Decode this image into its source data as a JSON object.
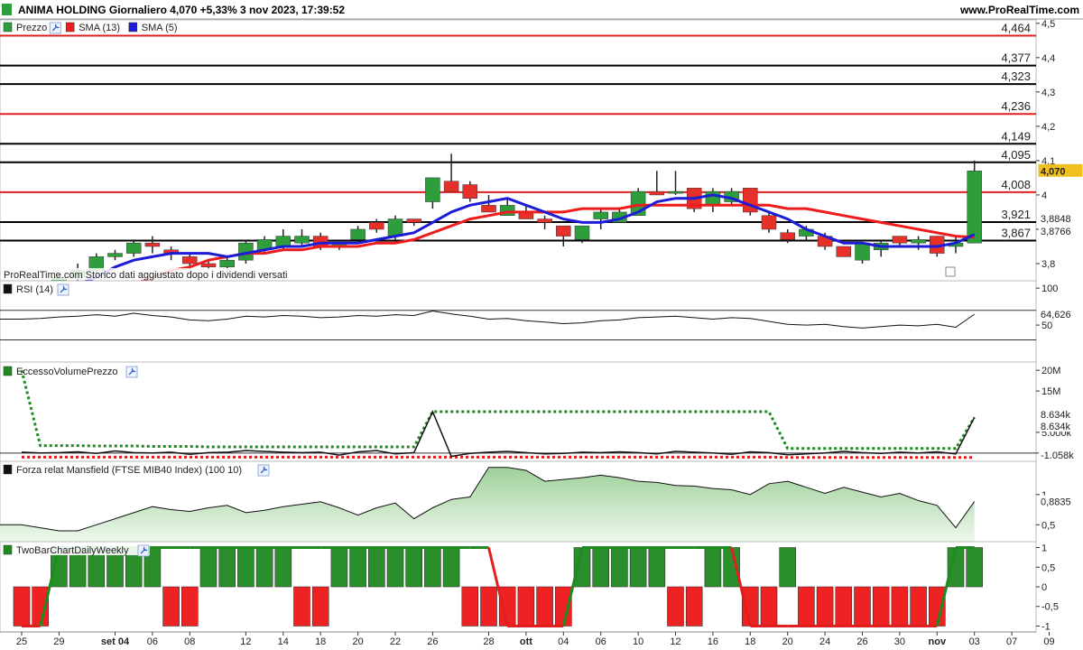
{
  "header": {
    "title": "ANIMA HOLDING Giornaliero 4,070 +5,33% 3 nov 2023, 17:39:52",
    "site": "www.ProRealTime.com"
  },
  "colors": {
    "up": "#2e9e3c",
    "down": "#e8302a",
    "sma13": "#ee1c1c",
    "sma5": "#1c1cd6",
    "current_price_bg": "#f0c020"
  },
  "chart_data": [
    {
      "id": "price",
      "type": "candlestick",
      "legend": [
        {
          "label": "Prezzo",
          "color": "#2e9e3c"
        },
        {
          "label": "SMA (13)",
          "color": "#ee1c1c"
        },
        {
          "label": "SMA (5)",
          "color": "#1c1cd6"
        }
      ],
      "ylim": [
        3.75,
        4.51
      ],
      "yticks": [
        3.8,
        3.9,
        4.0,
        4.1,
        4.2,
        4.3,
        4.4,
        4.5
      ],
      "ytick_labels": [
        "3,8",
        "3,9",
        "4",
        "4,1",
        "4,2",
        "4,3",
        "4,4",
        "4,5"
      ],
      "note": "ProRealTime.com Storico dati aggiustato dopo i dividendi versati",
      "candles": [
        [
          3.66,
          3.72,
          3.64,
          3.7
        ],
        [
          3.7,
          3.74,
          3.68,
          3.73
        ],
        [
          3.73,
          3.77,
          3.72,
          3.76
        ],
        [
          3.76,
          3.8,
          3.75,
          3.78
        ],
        [
          3.78,
          3.83,
          3.77,
          3.82
        ],
        [
          3.82,
          3.84,
          3.81,
          3.83
        ],
        [
          3.83,
          3.87,
          3.82,
          3.86
        ],
        [
          3.86,
          3.88,
          3.83,
          3.85
        ],
        [
          3.84,
          3.85,
          3.81,
          3.83
        ],
        [
          3.82,
          3.83,
          3.78,
          3.8
        ],
        [
          3.8,
          3.81,
          3.78,
          3.79
        ],
        [
          3.79,
          3.82,
          3.77,
          3.81
        ],
        [
          3.81,
          3.87,
          3.8,
          3.86
        ],
        [
          3.84,
          3.88,
          3.83,
          3.87
        ],
        [
          3.85,
          3.9,
          3.84,
          3.88
        ],
        [
          3.86,
          3.9,
          3.85,
          3.88
        ],
        [
          3.88,
          3.89,
          3.84,
          3.85
        ],
        [
          3.85,
          3.87,
          3.84,
          3.86
        ],
        [
          3.87,
          3.91,
          3.86,
          3.9
        ],
        [
          3.92,
          3.93,
          3.89,
          3.9
        ],
        [
          3.88,
          3.94,
          3.87,
          3.93
        ],
        [
          3.93,
          3.93,
          3.91,
          3.92
        ],
        [
          3.98,
          4.05,
          3.96,
          4.05
        ],
        [
          4.04,
          4.12,
          4.01,
          4.01
        ],
        [
          4.03,
          4.04,
          3.98,
          3.99
        ],
        [
          3.97,
          4.0,
          3.95,
          3.95
        ],
        [
          3.94,
          3.99,
          3.94,
          3.97
        ],
        [
          3.95,
          3.97,
          3.93,
          3.93
        ],
        [
          3.93,
          3.94,
          3.9,
          3.92
        ],
        [
          3.91,
          3.91,
          3.85,
          3.88
        ],
        [
          3.87,
          3.91,
          3.86,
          3.91
        ],
        [
          3.93,
          3.96,
          3.9,
          3.95
        ],
        [
          3.92,
          3.96,
          3.92,
          3.95
        ],
        [
          3.94,
          4.02,
          3.94,
          4.01
        ],
        [
          4.01,
          4.07,
          4.0,
          4.0
        ],
        [
          4.01,
          4.07,
          4.0,
          4.01
        ],
        [
          4.02,
          4.02,
          3.95,
          3.96
        ],
        [
          3.97,
          4.02,
          3.95,
          4.01
        ],
        [
          3.98,
          4.02,
          3.97,
          4.01
        ],
        [
          4.02,
          4.02,
          3.94,
          3.95
        ],
        [
          3.94,
          3.95,
          3.89,
          3.9
        ],
        [
          3.89,
          3.9,
          3.86,
          3.87
        ],
        [
          3.88,
          3.91,
          3.87,
          3.9
        ],
        [
          3.88,
          3.89,
          3.84,
          3.85
        ],
        [
          3.85,
          3.85,
          3.82,
          3.82
        ],
        [
          3.81,
          3.86,
          3.8,
          3.86
        ],
        [
          3.84,
          3.87,
          3.82,
          3.86
        ],
        [
          3.88,
          3.88,
          3.85,
          3.86
        ],
        [
          3.86,
          3.88,
          3.84,
          3.87
        ],
        [
          3.88,
          3.88,
          3.82,
          3.83
        ],
        [
          3.85,
          3.88,
          3.83,
          3.86
        ],
        [
          3.86,
          4.1,
          3.86,
          4.07
        ]
      ],
      "sma13": [
        3.59,
        3.62,
        3.64,
        3.66,
        3.69,
        3.72,
        3.74,
        3.76,
        3.78,
        3.79,
        3.81,
        3.82,
        3.83,
        3.83,
        3.84,
        3.84,
        3.85,
        3.85,
        3.85,
        3.86,
        3.86,
        3.87,
        3.89,
        3.91,
        3.93,
        3.94,
        3.95,
        3.95,
        3.95,
        3.95,
        3.96,
        3.96,
        3.96,
        3.97,
        3.97,
        3.97,
        3.97,
        3.97,
        3.97,
        3.97,
        3.97,
        3.96,
        3.96,
        3.95,
        3.94,
        3.93,
        3.92,
        3.91,
        3.9,
        3.89,
        3.88,
        3.8766
      ],
      "sma5": [
        3.65,
        3.68,
        3.71,
        3.74,
        3.76,
        3.79,
        3.81,
        3.82,
        3.83,
        3.83,
        3.83,
        3.82,
        3.83,
        3.84,
        3.85,
        3.85,
        3.86,
        3.86,
        3.86,
        3.87,
        3.88,
        3.89,
        3.92,
        3.95,
        3.97,
        3.98,
        3.99,
        3.97,
        3.95,
        3.93,
        3.92,
        3.92,
        3.93,
        3.95,
        3.98,
        3.99,
        3.99,
        4.0,
        3.99,
        3.97,
        3.95,
        3.93,
        3.9,
        3.88,
        3.86,
        3.86,
        3.85,
        3.85,
        3.85,
        3.85,
        3.86,
        3.8848
      ],
      "levels": [
        {
          "value": 4.464,
          "label": "4,464",
          "color": "#e02020"
        },
        {
          "value": 4.377,
          "label": "4,377",
          "color": "#000000"
        },
        {
          "value": 4.323,
          "label": "4,323",
          "color": "#000000"
        },
        {
          "value": 4.236,
          "label": "4,236",
          "color": "#e02020"
        },
        {
          "value": 4.149,
          "label": "4,149",
          "color": "#000000"
        },
        {
          "value": 4.095,
          "label": "4,095",
          "color": "#000000"
        },
        {
          "value": 4.008,
          "label": "4,008",
          "color": "#e02020"
        },
        {
          "value": 3.921,
          "label": "3,921",
          "color": "#000000"
        },
        {
          "value": 3.867,
          "label": "3,867",
          "color": "#000000"
        }
      ],
      "tags": [
        {
          "value": 4.07,
          "label": "4,070"
        },
        {
          "value": 3.8848,
          "label": "3,8848"
        },
        {
          "value": 3.8766,
          "label": "3,8766"
        }
      ]
    },
    {
      "id": "rsi",
      "type": "line",
      "legend": "RSI (14)",
      "ylim": [
        0,
        110
      ],
      "yticks": [
        {
          "value": 100,
          "label": "100"
        },
        {
          "value": 50,
          "label": "50"
        }
      ],
      "levels": [
        70,
        30
      ],
      "values": [
        58,
        59,
        61,
        62,
        64,
        62,
        66,
        63,
        61,
        57,
        56,
        58,
        62,
        61,
        63,
        62,
        60,
        61,
        63,
        62,
        64,
        63,
        69,
        65,
        62,
        58,
        59,
        56,
        54,
        52,
        53,
        56,
        57,
        60,
        61,
        62,
        60,
        58,
        60,
        59,
        55,
        51,
        50,
        51,
        48,
        46,
        48,
        50,
        49,
        51,
        47,
        64.626
      ],
      "tag": {
        "value": 64.626,
        "label": "64,626"
      }
    },
    {
      "id": "volume_excess",
      "type": "line",
      "legend": "EccessoVolumePrezzo",
      "ylim": [
        -2000000,
        22000000
      ],
      "yticks": [
        {
          "value": 20000000,
          "label": "20M"
        },
        {
          "value": 15000000,
          "label": "15M"
        },
        {
          "value": 5000000,
          "label": "5.000k"
        },
        {
          "value": 0,
          "label": "0"
        }
      ],
      "excess": [
        200000,
        0,
        100000,
        300000,
        -100000,
        500000,
        100000,
        0,
        200000,
        -300000,
        100000,
        200000,
        600000,
        400000,
        200000,
        100000,
        200000,
        -500000,
        300000,
        600000,
        -200000,
        100000,
        10000000,
        -800000,
        -100000,
        200000,
        400000,
        100000,
        -200000,
        -100000,
        200000,
        100000,
        300000,
        100000,
        -200000,
        400000,
        200000,
        0,
        -300000,
        300000,
        100000,
        -400000,
        -200000,
        0,
        400000,
        100000,
        -100000,
        200000,
        0,
        300000,
        -200000,
        8634000
      ],
      "upper": [
        20000000,
        1800000,
        1800000,
        1800000,
        1700000,
        1700000,
        1700000,
        1600000,
        1600000,
        1600000,
        1500000,
        1500000,
        1500000,
        1500000,
        1500000,
        1500000,
        1500000,
        1500000,
        1500000,
        1500000,
        1500000,
        1500000,
        10000000,
        10000000,
        10000000,
        10000000,
        10000000,
        10000000,
        10000000,
        10000000,
        10000000,
        10000000,
        10000000,
        10000000,
        10000000,
        10000000,
        10000000,
        10000000,
        10000000,
        10000000,
        10000000,
        1100000,
        1100000,
        1100000,
        1100000,
        1100000,
        1100000,
        1100000,
        1100000,
        1100000,
        1100000,
        8634000
      ],
      "lower": [
        -1000000,
        -1000000,
        -1000000,
        -1000000,
        -1000000,
        -1000000,
        -1000000,
        -1000000,
        -1000000,
        -1000000,
        -1000000,
        -1000000,
        -1000000,
        -1000000,
        -1000000,
        -1000000,
        -1000000,
        -1000000,
        -1000000,
        -1000000,
        -1000000,
        -1000000,
        -1000000,
        -1000000,
        -1000000,
        -1000000,
        -1000000,
        -1000000,
        -1000000,
        -1000000,
        -1000000,
        -1000000,
        -1000000,
        -1000000,
        -1000000,
        -1000000,
        -1000000,
        -1000000,
        -1000000,
        -1000000,
        -1000000,
        -1058000,
        -1058000,
        -1058000,
        -1058000,
        -1058000,
        -1058000,
        -1058000,
        -1058000,
        -1058000,
        -1058000,
        -1058000
      ],
      "tags": [
        {
          "value": 8634000,
          "label": "8.634k",
          "color": "#000000"
        },
        {
          "value": 8634000,
          "label": "8.634k",
          "color": "#2e9e3c"
        },
        {
          "value": -1058000,
          "label": "-1.058k",
          "color": "#e02020"
        }
      ]
    },
    {
      "id": "mansfield",
      "type": "area",
      "legend": "Forza relat Mansfield (FTSE MIB40 Index) (100 10)",
      "ylim": [
        0.22,
        1.55
      ],
      "yticks": [
        {
          "value": 1,
          "label": "1"
        },
        {
          "value": 0.5,
          "label": "0,5"
        }
      ],
      "values": [
        0.5,
        0.45,
        0.4,
        0.4,
        0.5,
        0.6,
        0.7,
        0.8,
        0.75,
        0.72,
        0.78,
        0.82,
        0.7,
        0.74,
        0.8,
        0.84,
        0.88,
        0.78,
        0.66,
        0.78,
        0.86,
        0.6,
        0.78,
        0.92,
        0.96,
        1.45,
        1.45,
        1.4,
        1.22,
        1.25,
        1.28,
        1.32,
        1.28,
        1.22,
        1.2,
        1.15,
        1.14,
        1.1,
        1.08,
        1.0,
        1.18,
        1.22,
        1.12,
        1.02,
        1.12,
        1.04,
        0.96,
        1.02,
        0.9,
        0.82,
        0.45,
        0.8835
      ],
      "tag": {
        "value": 0.8835,
        "label": "0,8835"
      }
    },
    {
      "id": "twobar",
      "type": "bar",
      "legend": "TwoBarChartDailyWeekly",
      "ylim": [
        -1.15,
        1.15
      ],
      "yticks": [
        {
          "value": 1,
          "label": "1"
        },
        {
          "value": 0.5,
          "label": "0,5"
        },
        {
          "value": 0,
          "label": "0"
        },
        {
          "value": -0.5,
          "label": "-0,5"
        },
        {
          "value": -1,
          "label": "-1"
        }
      ],
      "daily": [
        -1,
        -1,
        1,
        1,
        1,
        1,
        1,
        1,
        -1,
        -1,
        1,
        1,
        1,
        1,
        1,
        -1,
        -1,
        1,
        1,
        1,
        1,
        1,
        1,
        1,
        -1,
        -1,
        -1,
        -1,
        -1,
        -1,
        1,
        1,
        1,
        1,
        1,
        -1,
        -1,
        1,
        1,
        -1,
        -1,
        1,
        -1,
        -1,
        -1,
        -1,
        -1,
        -1,
        -1,
        -1,
        1,
        1
      ],
      "weekly": [
        -1,
        -1,
        1,
        1,
        1,
        1,
        1,
        1,
        1,
        1,
        1,
        1,
        1,
        1,
        1,
        1,
        1,
        1,
        1,
        1,
        1,
        1,
        1,
        1,
        1,
        1,
        -1,
        -1,
        -1,
        -1,
        1,
        1,
        1,
        1,
        1,
        1,
        1,
        1,
        1,
        -1,
        -1,
        -1,
        -1,
        -1,
        -1,
        -1,
        -1,
        -1,
        -1,
        -1,
        1,
        1
      ]
    }
  ],
  "xaxis": {
    "ticks": [
      {
        "index": 0,
        "label": "25"
      },
      {
        "index": 2,
        "label": "29"
      },
      {
        "index": 5,
        "label": "set 04"
      },
      {
        "index": 7,
        "label": "06"
      },
      {
        "index": 9,
        "label": "08"
      },
      {
        "index": 12,
        "label": "12"
      },
      {
        "index": 14,
        "label": "14"
      },
      {
        "index": 16,
        "label": "18"
      },
      {
        "index": 18,
        "label": "20"
      },
      {
        "index": 20,
        "label": "22"
      },
      {
        "index": 22,
        "label": "26"
      },
      {
        "index": 25,
        "label": "28"
      },
      {
        "index": 27,
        "label": "ott"
      },
      {
        "index": 29,
        "label": "04"
      },
      {
        "index": 31,
        "label": "06"
      },
      {
        "index": 33,
        "label": "10"
      },
      {
        "index": 35,
        "label": "12"
      },
      {
        "index": 37,
        "label": "16"
      },
      {
        "index": 39,
        "label": "18"
      },
      {
        "index": 41,
        "label": "20"
      },
      {
        "index": 43,
        "label": "24"
      },
      {
        "index": 45,
        "label": "26"
      },
      {
        "index": 47,
        "label": "30"
      },
      {
        "index": 49,
        "label": "nov"
      },
      {
        "index": 51,
        "label": "03"
      },
      {
        "index": 53,
        "label": "07"
      },
      {
        "index": 55,
        "label": "09"
      }
    ]
  }
}
